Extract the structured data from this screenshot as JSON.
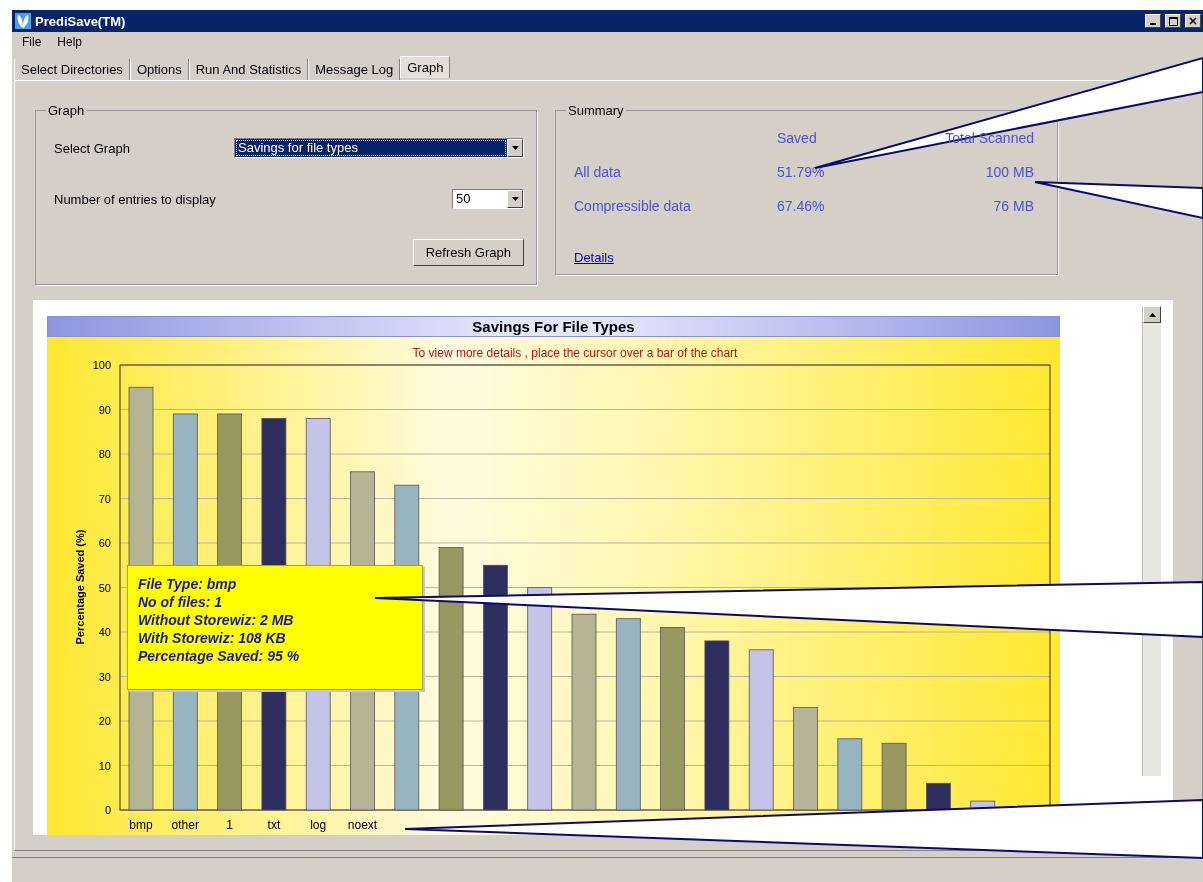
{
  "window": {
    "title": "PrediSave(TM)"
  },
  "menu": [
    "File",
    "Help"
  ],
  "tabs": [
    {
      "label": "Select Directories",
      "selected": false
    },
    {
      "label": "Options",
      "selected": false
    },
    {
      "label": "Run And Statistics",
      "selected": false
    },
    {
      "label": "Message Log",
      "selected": false
    },
    {
      "label": "Graph",
      "selected": true
    }
  ],
  "graph_group": {
    "title": "Graph",
    "select_graph": {
      "label": "Select Graph",
      "value": "Savings for file types"
    },
    "entries": {
      "label": "Number of entries to display",
      "value": "50"
    },
    "refresh_button": "Refresh Graph"
  },
  "summary": {
    "title": "Summary",
    "columns": [
      "Saved",
      "Total Scanned"
    ],
    "rows": [
      {
        "label": "All data",
        "saved": "51.79%",
        "total": "100 MB"
      },
      {
        "label": "Compressible data",
        "saved": "67.46%",
        "total": "76 MB"
      }
    ],
    "details_link": "Details"
  },
  "chart": {
    "subtitle": "To view more details , place the cursor over a bar of the chart",
    "tooltip": [
      "File Type: bmp",
      "No of files: 1",
      "Without Storewiz: 2 MB",
      "With Storewiz: 108 KB",
      "Percentage Saved: 95 %"
    ],
    "chart_data": {
      "type": "bar",
      "title": "Savings For File Types",
      "ylabel": "Percentage Saved (%)",
      "categories": [
        "bmp",
        "other",
        "1",
        "txt",
        "log",
        "noext",
        null,
        null,
        null,
        null,
        null,
        null,
        null,
        null,
        null,
        null,
        null,
        null,
        null,
        null
      ],
      "values": [
        95,
        89,
        89,
        88,
        88,
        76,
        73,
        59,
        55,
        50,
        44,
        43,
        41,
        38,
        36,
        23,
        16,
        15,
        6,
        2
      ],
      "ylim": [
        0,
        100
      ],
      "yticks": [
        0,
        10,
        20,
        30,
        40,
        50,
        60,
        70,
        80,
        90,
        100
      ],
      "grid": true
    }
  }
}
